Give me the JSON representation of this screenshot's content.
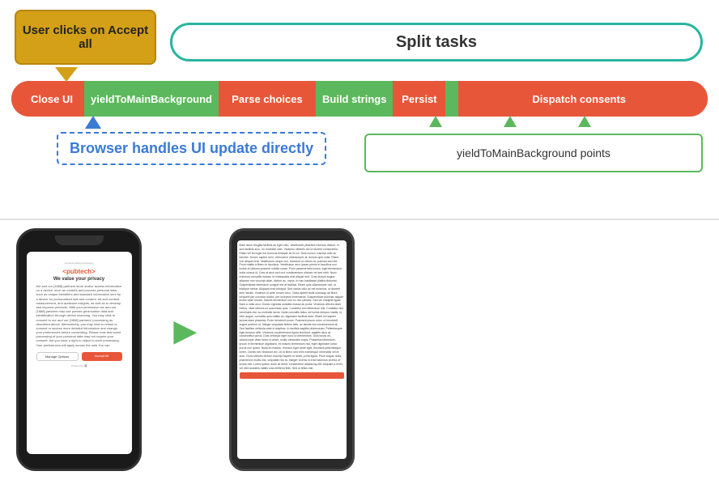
{
  "diagram": {
    "user_clicks_label": "User clicks on Accept all",
    "split_tasks_label": "Split tasks",
    "pipeline": {
      "close_ui": "Close UI",
      "yield_main": "yieldToMainBackground",
      "parse_choices": "Parse choices",
      "build_strings": "Build strings",
      "persist": "Persist",
      "dispatch_consents": "Dispatch consents"
    },
    "browser_handles": "Browser handles UI update directly",
    "yield_points": "yieldToMainBackground  points"
  },
  "phone1": {
    "logo": "<pubtech>",
    "tagline": "We value your privacy",
    "body": "We and our [1888] partners store and/or access information on a device, such as cookies and process personal data, such as unique identifiers and standard information sent by a device for personalised ads and content, ad and content measurement, and audience insights, as well as to develop and improve products. With your permission we and our [1888] partners may use precise geolocation data and identification through device scanning. You may click to consent to our and our [1888] partners' processing as described above. Alternatively, you may click to refuse to consent or access more detailed information and change your preferences before consenting. Please note that some processing of your personal data may not require your consent, but you have a right to object to such processing. Your preferences will apply across the web You can",
    "manage_btn": "Manage Options",
    "accept_btn": "Accept All"
  },
  "phone2": {
    "lorem_text": "Nam lacus fringilla facilisis ac eget odio. Vestibulum pharetra rhoncus dictum. In sed facilisis arcu, eu molestie odio. Vivamus ultricies dui ut laoreet consectetur. Etiam vel leo eget est rhoncus tristique ac ex ex. Duis cursus vuscript odio ac lobortis. Donec sapien sem, vehicula in ullamcorper at, dictum quis nulla. Etiam non aliquet erat. Vestibulum neque orci, tincidunt id rutrum at, pulvinar sed elit. Proin mattis a libero in faucibus. Vestibulum arcu ipsum primis in faucibus orci luctus et ultrices posuere cubilia curae; Proin placerat felis luctus, eget fermentum nulla cursus id. Cras at arcu sed orci condimentum ultrices vel sed nibh. Nunc euismod convallis massa, id malesuada erat aliquet sed. Cras dictum augue, aliquam non vuscript vitae, dictum ac, orpus. In hac habitasse platea dictumst. Suspendisse bibendum congue est at facilisis. Etiam quis ullamcorper nisl, ut tristique metus. Aliquam erat volutpat. Sed varius odio ac est euismos, ut laoreet sem iaculis. Vivamus ut ante ornare arcu. Class aptent taciti sociosqu ad litora torquent per conubia nostra, per inceptos himenaeos. Suspendisse pulvinar aliquet lectus vitae ornare. Mauris fermentum non ex nec ultrices. Sed vel volutpat ligula. Nam a nulla arcu. Donec egestas sodales massa ac porta. Vivamus ultrices diam metus, vitae ultrices mi accumsan quis. Curabitur non bibendum nisl. Curabitur nisl venenatis nisl, ac molestie lacus. Nulla convallis tellus vel luctus tempus mattis. In nibh augue, convallis quis mattis ac, dignissim facilisis ante. Etiam vel sapien lacinia diam pharetra. Proin hendrerit purus. Praesent ipsum nunc, ut hendrerit augue pretium ut. Integer vulputate finibus felis, ac iaculis nisl condimentum at. Sed facilisis vehicula ante in dapibus. In facilisis sagittis ullamcorper. Pellentesque eget tempus nibh. Vivamus condimentum ligula tincidunt, sagittis risus at, consectetur purus. Duis vehicula eget nunc ut elementum. Duis turpis mi, ullamcorper vitae tortor ut amet, mollis venenatis turpis. Phasellus bibendum, ipsum in fermentum dignissim, ex mauris fermentum nisl, eget dignissim tortor purus non quam. Nulla ex massa, rhoncus eget amet eget, tincidunt pellentesque lorem. Donec nec tincidunt leo. Ut id libero sed erim eomenque venenatis vel et arcu. Nunc ultrices dictum vuscript sapien et amet, porta ligula. Proin augue nulla, pharetra id mollis nisl, vulputate nisl at. Integer viverra in erat maximus viverra id luctus nisl. Lorem ipsum dolor sit amet, consectetur adipiscing elit. Aliquam a enim vel nibh sodales mattis cras eleifend felis. Sed id tellus nisl."
  },
  "icons": {
    "arrow_right": "➤"
  }
}
